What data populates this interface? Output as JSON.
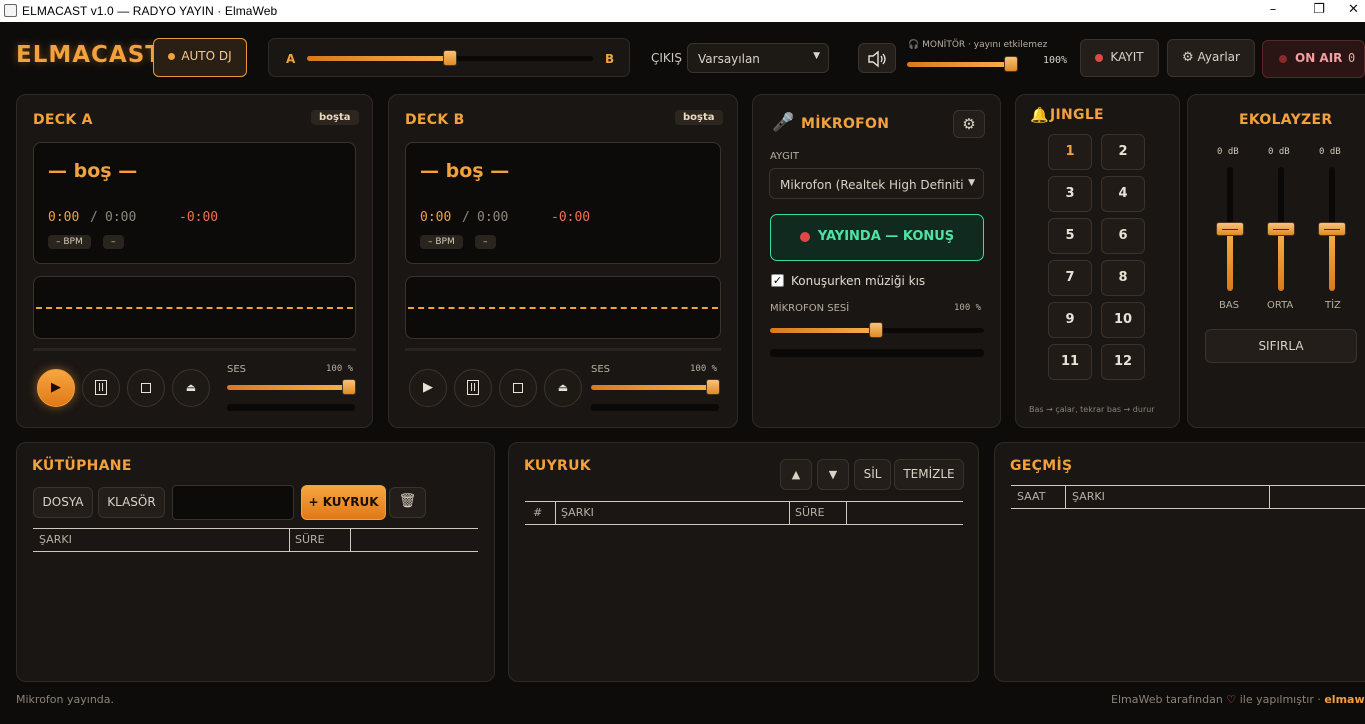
{
  "window": {
    "title": "ELMACAST v1.0 — RADYO YAYIN  ·  ElmaWeb",
    "minimize": "–",
    "maximize": "❐",
    "close": "✕"
  },
  "header": {
    "logo": "ELMACAST",
    "auto_dj": "AUTO DJ",
    "crossfader": {
      "left": "A",
      "right": "B",
      "value": 0.5
    },
    "output_label": "ÇIKIŞ",
    "output_value": "Varsayılan",
    "monitor_label": "MONİTÖR · yayını etkilemez",
    "monitor_value": "100%",
    "record_label": "KAYIT",
    "settings_label": "Ayarlar",
    "onair_label": "ON AIR",
    "onair_count": "0"
  },
  "decks": [
    {
      "title": "DECK A",
      "status": "boşta",
      "track": "— boş —",
      "time": "0:00",
      "total": "0:00",
      "slash": "/",
      "remaining": "-0:00",
      "bpm": "– BPM",
      "key": "–",
      "volume_label": "SES",
      "volume_value": "100 %",
      "volume": 1.0
    },
    {
      "title": "DECK B",
      "status": "boşta",
      "track": "— boş —",
      "time": "0:00",
      "total": "0:00",
      "slash": "/",
      "remaining": "-0:00",
      "bpm": "– BPM",
      "key": "–",
      "volume_label": "SES",
      "volume_value": "100 %",
      "volume": 1.0
    }
  ],
  "mic": {
    "title": "MİKROFON",
    "device_label": "AYGIT",
    "device_value": "Mikrofon (Realtek High Definiti",
    "onair_button": "YAYINDA — KONUŞ",
    "duck_label": "Konuşurken müziği kıs",
    "level_label": "MİKROFON SESİ",
    "level_value": "100 %",
    "level": 0.5
  },
  "jingle": {
    "title": "JINGLE",
    "buttons": [
      "1",
      "2",
      "3",
      "4",
      "5",
      "6",
      "7",
      "8",
      "9",
      "10",
      "11",
      "12"
    ],
    "hint": "Bas → çalar, tekrar bas → durur"
  },
  "eq": {
    "title": "EKOLAYZER",
    "bands": [
      {
        "label": "BAS",
        "value": "0 dB"
      },
      {
        "label": "ORTA",
        "value": "0 dB"
      },
      {
        "label": "TİZ",
        "value": "0 dB"
      }
    ],
    "reset": "SIFIRLA"
  },
  "library": {
    "title": "KÜTÜPHANE",
    "file_btn": "DOSYA",
    "folder_btn": "KLASÖR",
    "search_placeholder": "",
    "queue_btn": "+ KUYRUK",
    "columns": [
      "ŞARKI",
      "SÜRE"
    ]
  },
  "queue": {
    "title": "KUYRUK",
    "up": "▲",
    "down": "▼",
    "delete": "SİL",
    "clear": "TEMİZLE",
    "columns": [
      "#",
      "ŞARKI",
      "SÜRE"
    ]
  },
  "history": {
    "title": "GEÇMİŞ",
    "columns": [
      "SAAT",
      "ŞARKI"
    ]
  },
  "footer": {
    "status": "Mikrofon yayında.",
    "credit_prefix": "ElmaWeb tarafından",
    "credit_suffix": "ile yapılmıştır ·",
    "credit_link": "elmaweb."
  },
  "colors": {
    "accent": "#f2a13c",
    "panel": "#1a1613",
    "onair": "#e05050",
    "green": "#3ddc97"
  }
}
